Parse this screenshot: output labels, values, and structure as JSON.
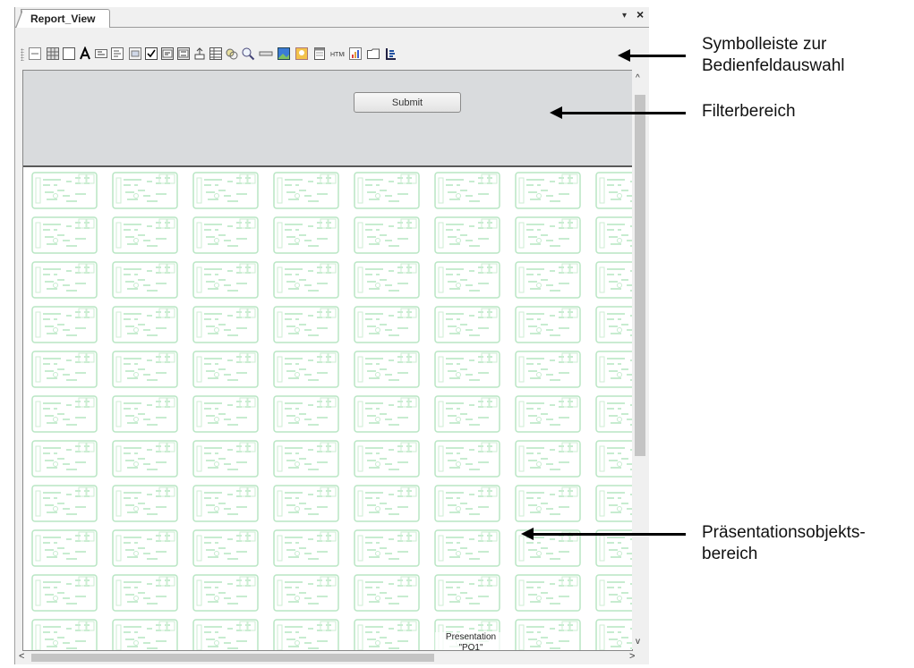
{
  "window": {
    "tab_label": "Report_View",
    "dropdown_glyph": "▾",
    "close_glyph": "×"
  },
  "toolbar": {
    "icons": [
      "collapse-panel-icon",
      "table-grid-icon",
      "panel-box-icon",
      "text-label-icon",
      "text-field-icon",
      "text-box-icon",
      "list-box-icon",
      "checkbox-icon",
      "combo-box-icon",
      "spin-box-icon",
      "upload-icon",
      "data-grid-icon",
      "link-icon",
      "search-icon",
      "separator-icon",
      "image-icon",
      "user-icon",
      "calendar-icon",
      "html-icon",
      "chart-icon",
      "folder-icon",
      "tree-icon"
    ]
  },
  "filter": {
    "submit_label": "Submit",
    "background": "#d9dbdd"
  },
  "presentation": {
    "label_line1": "Presentation",
    "label_line2": "\"PO1\"",
    "tile_color": "#b9e6c4"
  },
  "scrollbars": {
    "up": "^",
    "down": "v",
    "left": "<",
    "right": ">"
  },
  "annotations": {
    "toolbar_line1": "Symbolleiste zur",
    "toolbar_line2": "Bedienfeldauswahl",
    "filter": "Filterbereich",
    "presentation_line1": "Präsentationsobjekts-",
    "presentation_line2": "bereich"
  }
}
